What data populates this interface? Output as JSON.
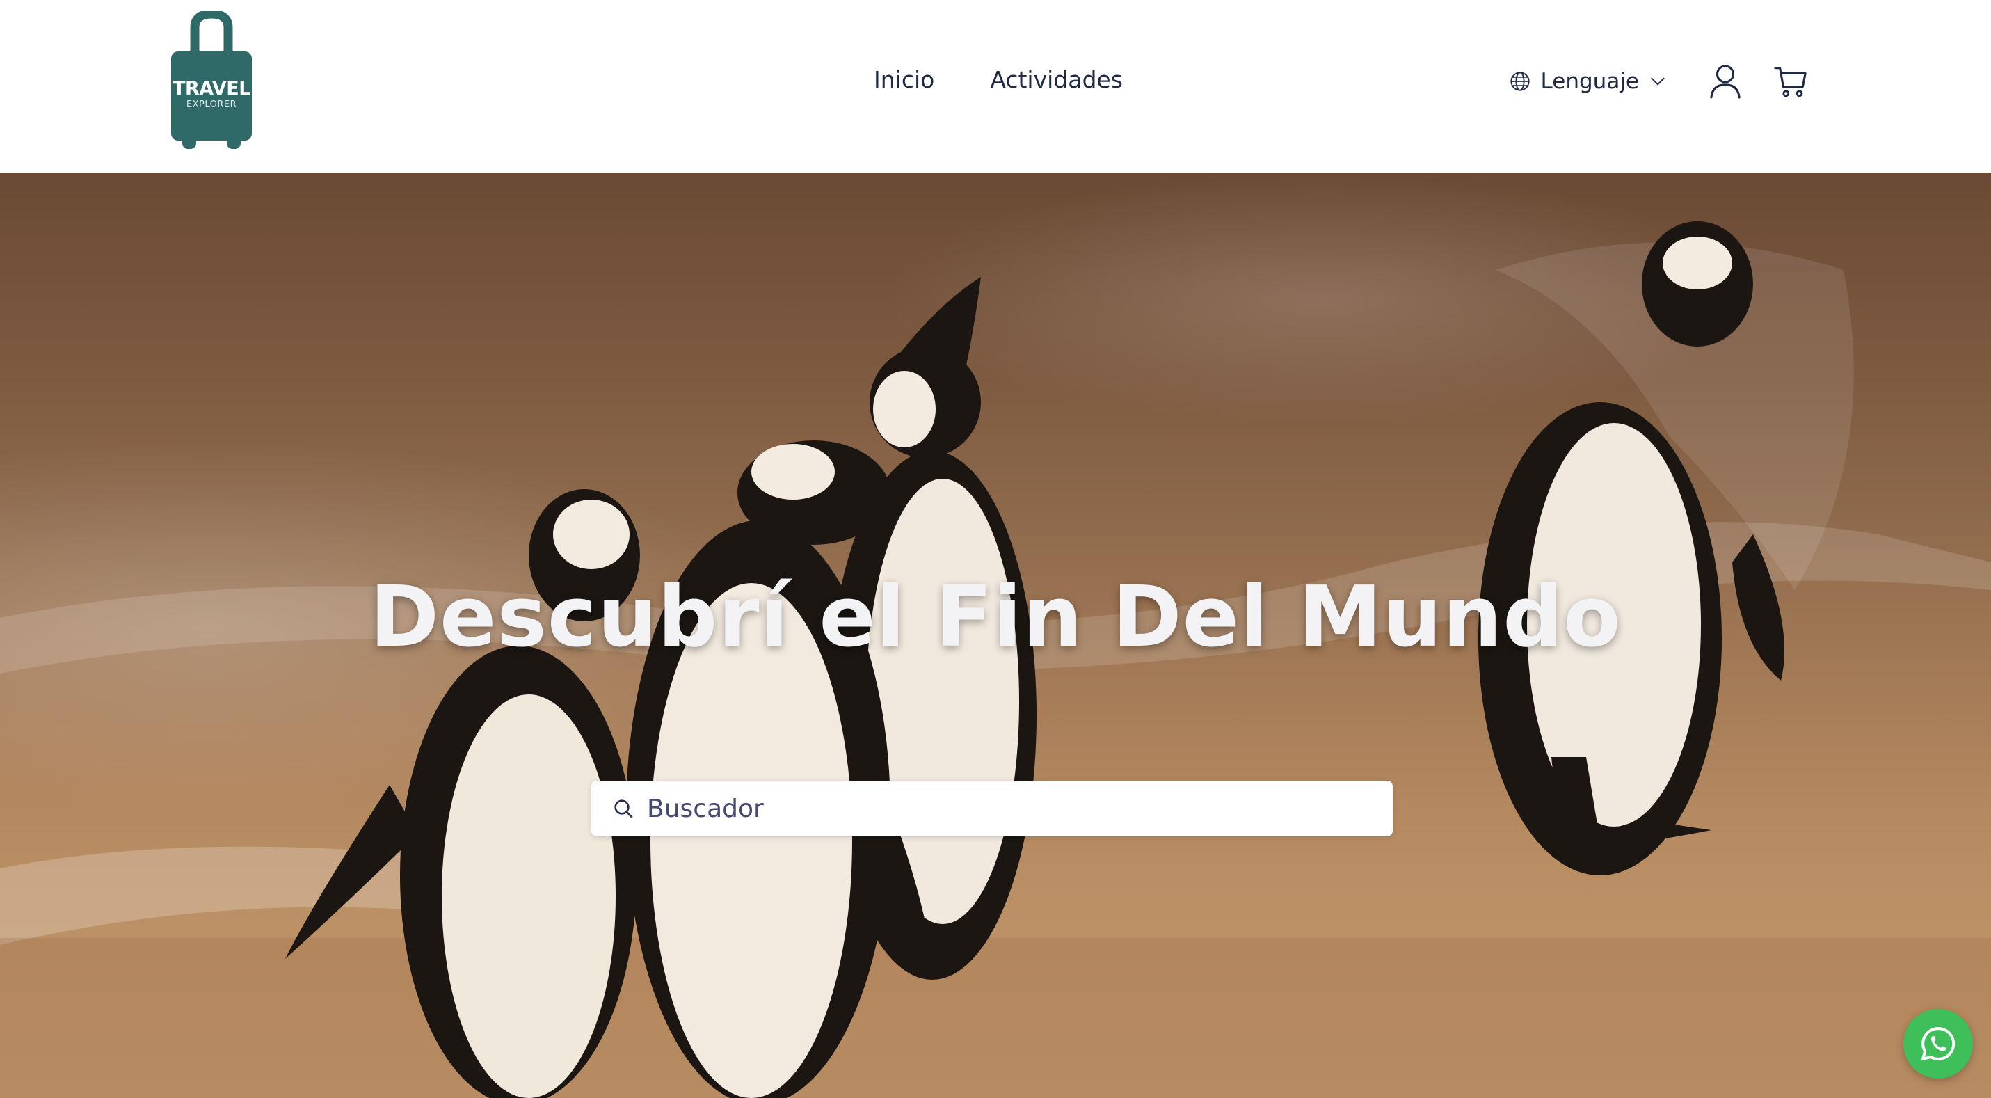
{
  "header": {
    "logo": {
      "title": "TRAVEL",
      "subtitle": "EXPLORER",
      "icon": "suitcase-logo",
      "color": "#2f6a68"
    },
    "nav": [
      {
        "label": "Inicio"
      },
      {
        "label": "Actividades"
      }
    ],
    "language": {
      "label": "Lenguaje",
      "icon": "globe-icon"
    },
    "user_icon": "user-icon",
    "cart_icon": "cart-icon"
  },
  "hero": {
    "title": "Descubrí el Fin Del Mundo",
    "background": "penguins-on-beach-photo",
    "search": {
      "placeholder": "Buscador",
      "value": ""
    }
  },
  "floating": {
    "whatsapp_icon": "whatsapp-icon",
    "color": "#3fbf5a"
  },
  "colors": {
    "text_dark": "#1f2a44",
    "search_text": "#444a70"
  }
}
